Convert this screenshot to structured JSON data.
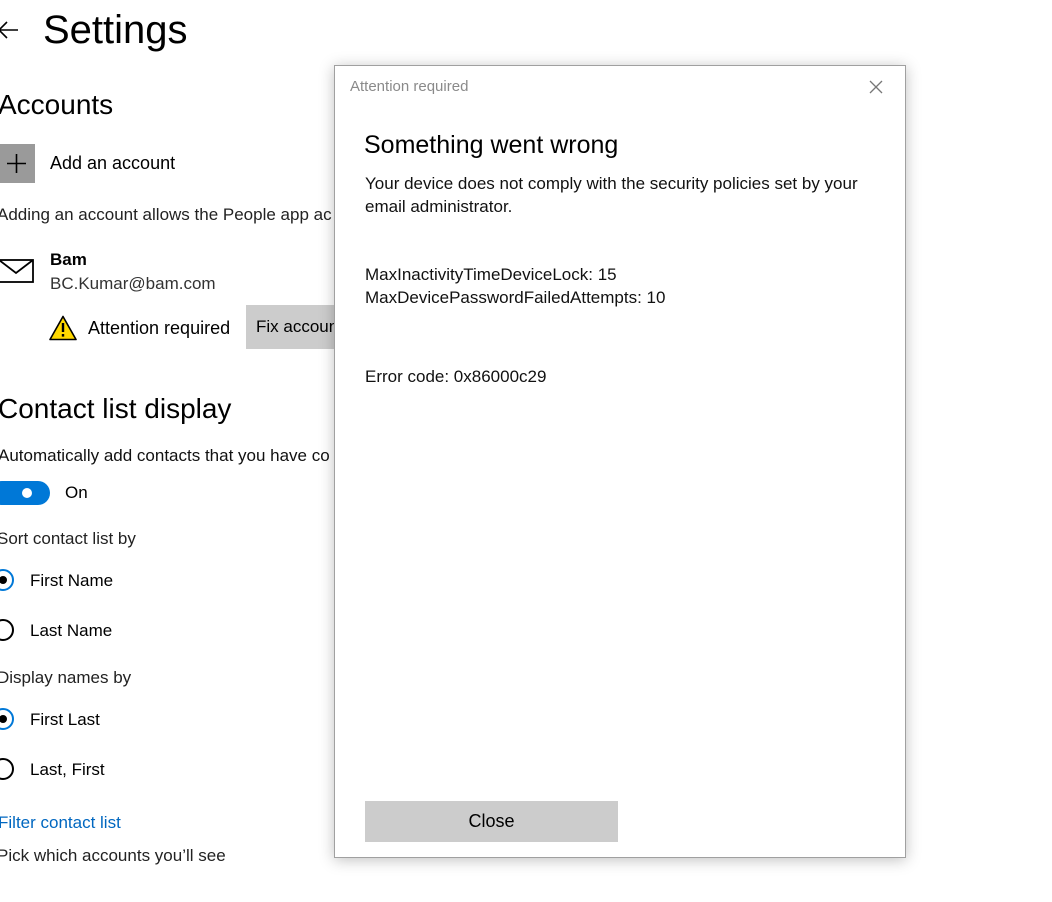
{
  "settings": {
    "title": "Settings",
    "accounts": {
      "heading": "Accounts",
      "add_account_label": "Add an account",
      "adding_description": "Adding an account allows the People app ac",
      "account": {
        "name": "Bam",
        "email": "BC.Kumar@bam.com",
        "status": "Attention required",
        "fix_button": "Fix accoun"
      }
    },
    "contact_list": {
      "heading": "Contact list display",
      "auto_add_label": "Automatically add contacts that you have co",
      "toggle_state": "On",
      "sort_label": "Sort contact list by",
      "sort_options": [
        {
          "label": "First Name",
          "selected": true
        },
        {
          "label": "Last Name",
          "selected": false
        }
      ],
      "display_label": "Display names by",
      "display_options": [
        {
          "label": "First Last",
          "selected": true
        },
        {
          "label": "Last, First",
          "selected": false
        }
      ],
      "filter_link": "Filter contact list",
      "pick_description": "Pick which accounts you’ll see"
    }
  },
  "dialog": {
    "title": "Attention required",
    "heading": "Something went wrong",
    "message": "Your device does not comply with the security policies set by your email administrator.",
    "policies": [
      "MaxInactivityTimeDeviceLock: 15",
      "MaxDevicePasswordFailedAttempts: 10"
    ],
    "error_code": "Error code: 0x86000c29",
    "close_button": "Close"
  },
  "colors": {
    "accent": "#0078d7",
    "link": "#0067c0",
    "button_gray": "#cccccc",
    "warning_yellow": "#ffd800"
  }
}
